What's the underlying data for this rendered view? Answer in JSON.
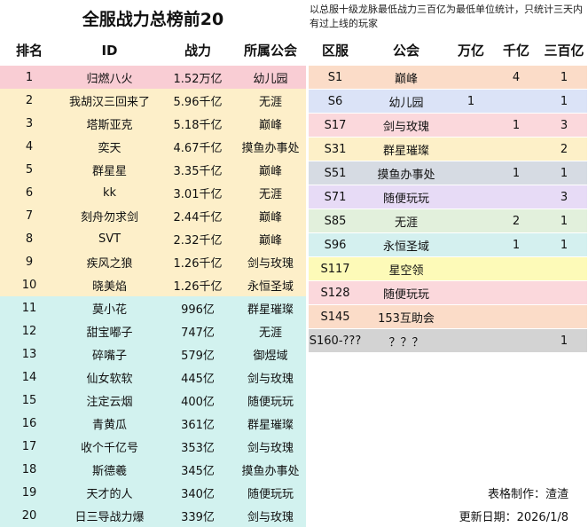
{
  "title": "全服战力总榜前20",
  "note": "以总服十级龙脉最低战力三百亿为最低单位统计，只统计三天内有过上线的玩家",
  "rank_headers": [
    "排名",
    "ID",
    "战力",
    "所属公会"
  ],
  "rankings": [
    {
      "rank": "1",
      "id": "归燃八火",
      "power": "1.52万亿",
      "guild": "幼儿园"
    },
    {
      "rank": "2",
      "id": "我胡汉三回来了",
      "power": "5.96千亿",
      "guild": "无涯"
    },
    {
      "rank": "3",
      "id": "塔斯亚克",
      "power": "5.18千亿",
      "guild": "巅峰"
    },
    {
      "rank": "4",
      "id": "奕天",
      "power": "4.67千亿",
      "guild": "摸鱼办事处"
    },
    {
      "rank": "5",
      "id": "群星星",
      "power": "3.35千亿",
      "guild": "巅峰"
    },
    {
      "rank": "6",
      "id": "kk",
      "power": "3.01千亿",
      "guild": "无涯"
    },
    {
      "rank": "7",
      "id": "刻舟勿求剑",
      "power": "2.44千亿",
      "guild": "巅峰"
    },
    {
      "rank": "8",
      "id": "SVT",
      "power": "2.32千亿",
      "guild": "巅峰"
    },
    {
      "rank": "9",
      "id": "疾风之狼",
      "power": "1.26千亿",
      "guild": "剑与玫瑰"
    },
    {
      "rank": "10",
      "id": "晓美焰",
      "power": "1.26千亿",
      "guild": "永恒圣域"
    },
    {
      "rank": "11",
      "id": "莫小花",
      "power": "996亿",
      "guild": "群星璀璨"
    },
    {
      "rank": "12",
      "id": "甜宝嘟子",
      "power": "747亿",
      "guild": "无涯"
    },
    {
      "rank": "13",
      "id": "碎嘴子",
      "power": "579亿",
      "guild": "御煜域"
    },
    {
      "rank": "14",
      "id": "仙女软软",
      "power": "445亿",
      "guild": "剑与玫瑰"
    },
    {
      "rank": "15",
      "id": "注定云烟",
      "power": "400亿",
      "guild": "随便玩玩"
    },
    {
      "rank": "16",
      "id": "青黄瓜",
      "power": "361亿",
      "guild": "群星璀璨"
    },
    {
      "rank": "17",
      "id": "收个千亿号",
      "power": "353亿",
      "guild": "剑与玫瑰"
    },
    {
      "rank": "18",
      "id": "斯德羲",
      "power": "345亿",
      "guild": "摸鱼办事处"
    },
    {
      "rank": "19",
      "id": "天才的人",
      "power": "340亿",
      "guild": "随便玩玩"
    },
    {
      "rank": "20",
      "id": "日三导战力爆",
      "power": "339亿",
      "guild": "剑与玫瑰"
    }
  ],
  "server_headers": [
    "区服",
    "公会",
    "万亿",
    "千亿",
    "三百亿"
  ],
  "servers": [
    {
      "server": "S1",
      "guild": "巅峰",
      "wanyi": "",
      "qianyi": "4",
      "sanbaiyi": "1"
    },
    {
      "server": "S6",
      "guild": "幼儿园",
      "wanyi": "1",
      "qianyi": "",
      "sanbaiyi": "1"
    },
    {
      "server": "S17",
      "guild": "剑与玫瑰",
      "wanyi": "",
      "qianyi": "1",
      "sanbaiyi": "3"
    },
    {
      "server": "S31",
      "guild": "群星璀璨",
      "wanyi": "",
      "qianyi": "",
      "sanbaiyi": "2"
    },
    {
      "server": "S51",
      "guild": "摸鱼办事处",
      "wanyi": "",
      "qianyi": "1",
      "sanbaiyi": "1"
    },
    {
      "server": "S71",
      "guild": "随便玩玩",
      "wanyi": "",
      "qianyi": "",
      "sanbaiyi": "3"
    },
    {
      "server": "S85",
      "guild": "无涯",
      "wanyi": "",
      "qianyi": "2",
      "sanbaiyi": "1"
    },
    {
      "server": "S96",
      "guild": "永恒圣域",
      "wanyi": "",
      "qianyi": "1",
      "sanbaiyi": "1"
    },
    {
      "server": "S117",
      "guild": "星空领",
      "wanyi": "",
      "qianyi": "",
      "sanbaiyi": ""
    },
    {
      "server": "S128",
      "guild": "随便玩玩",
      "wanyi": "",
      "qianyi": "",
      "sanbaiyi": ""
    },
    {
      "server": "S145",
      "guild": "153互助会",
      "wanyi": "",
      "qianyi": "",
      "sanbaiyi": ""
    },
    {
      "server": "S160-???",
      "guild": "？？？",
      "wanyi": "",
      "qianyi": "",
      "sanbaiyi": "1"
    }
  ],
  "footer": {
    "made_by": "表格制作：渣渣",
    "updated": "更新日期：2026/1/8"
  },
  "colors": {
    "rank_top": "#f9cdd4",
    "rank_mid": "#fdefc9",
    "rank_low": "#d2f2ef",
    "servers": [
      "#fbdcc8",
      "#dbe3f7",
      "#fbd8dc",
      "#fdf0c8",
      "#d6dbe3",
      "#e7dbf6",
      "#e2f0dc",
      "#d4f0ef",
      "#fdfab8",
      "#fbd8dc",
      "#fbdcc8",
      "#d3d3d3"
    ]
  }
}
